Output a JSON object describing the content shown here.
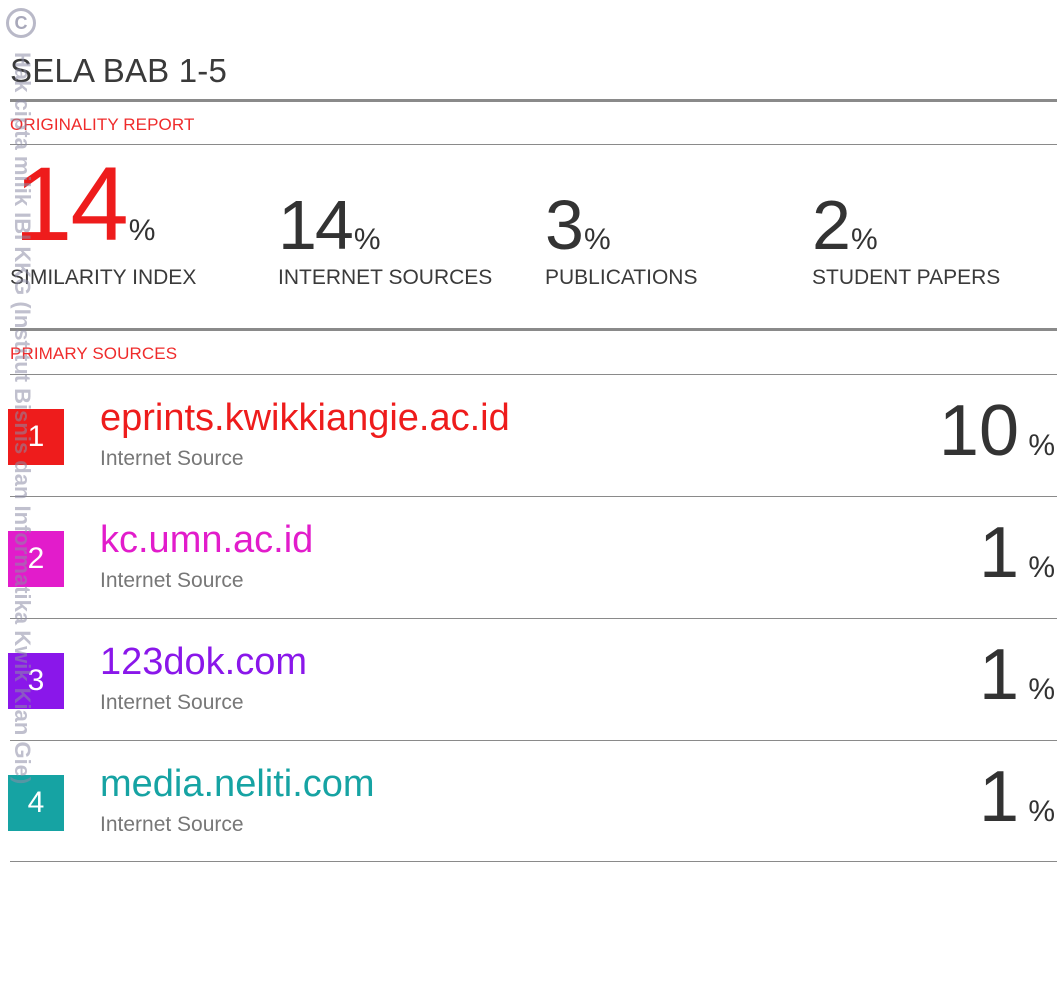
{
  "document": {
    "title": "SELA BAB 1-5"
  },
  "originality_report": {
    "label": "ORIGINALITY REPORT",
    "similarity_index": {
      "value": "14",
      "unit": "%",
      "caption": "SIMILARITY INDEX"
    },
    "internet_sources": {
      "value": "14",
      "unit": "%",
      "caption": "INTERNET SOURCES"
    },
    "publications": {
      "value": "3",
      "unit": "%",
      "caption": "PUBLICATIONS"
    },
    "student_papers": {
      "value": "2",
      "unit": "%",
      "caption": "STUDENT PAPERS"
    }
  },
  "primary_sources": {
    "label": "PRIMARY SOURCES",
    "items": [
      {
        "rank": "1",
        "site": "eprints.kwikkiangie.ac.id",
        "type": "Internet Source",
        "value": "10",
        "unit": "%",
        "color": "#ee1c1c"
      },
      {
        "rank": "2",
        "site": "kc.umn.ac.id",
        "type": "Internet Source",
        "value": "1",
        "unit": "%",
        "color": "#e21ccb"
      },
      {
        "rank": "3",
        "site": "123dok.com",
        "type": "Internet Source",
        "value": "1",
        "unit": "%",
        "color": "#8a17ea"
      },
      {
        "rank": "4",
        "site": "media.neliti.com",
        "type": "Internet Source",
        "value": "1",
        "unit": "%",
        "color": "#16a3a3"
      }
    ]
  },
  "watermark": {
    "symbol": "C",
    "text": "Hak cipta milik IBI KKG (Institut Bisnis dan Informatika Kwik Kian Gie)"
  }
}
